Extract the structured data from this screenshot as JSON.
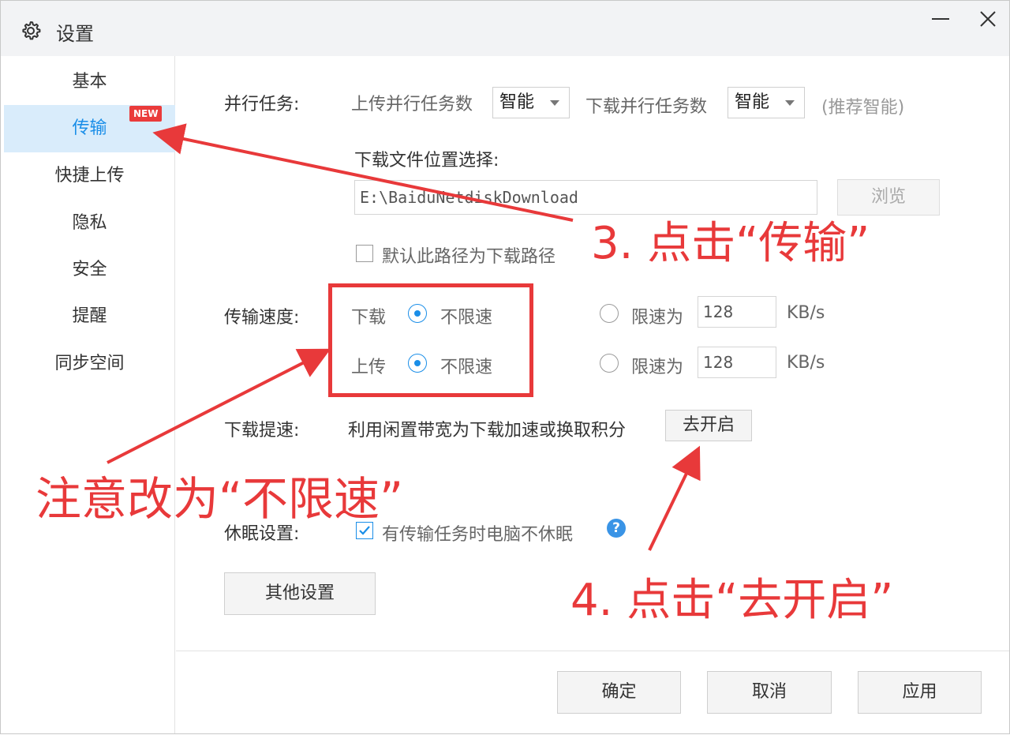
{
  "window": {
    "title": "设置"
  },
  "sidebar": {
    "items": [
      {
        "label": "基本"
      },
      {
        "label": "传输"
      },
      {
        "label": "快捷上传"
      },
      {
        "label": "隐私"
      },
      {
        "label": "安全"
      },
      {
        "label": "提醒"
      },
      {
        "label": "同步空间"
      }
    ],
    "new_badge": "NEW",
    "active_index": 1
  },
  "parallel": {
    "label": "并行任务:",
    "upload_label": "上传并行任务数",
    "upload_value": "智能",
    "download_label": "下载并行任务数",
    "download_value": "智能",
    "hint": "(推荐智能)"
  },
  "download_path": {
    "label": "下载文件位置选择:",
    "value": "E:\\BaiduNetdiskDownload",
    "browse_button": "浏览",
    "default_checkbox": "默认此路径为下载路径",
    "default_checked": false
  },
  "speed": {
    "label": "传输速度:",
    "download_label": "下载",
    "upload_label": "上传",
    "unlimited": "不限速",
    "limited": "限速为",
    "download_limit": "128",
    "upload_limit": "128",
    "unit": "KB/s",
    "download_mode": "unlimited",
    "upload_mode": "unlimited"
  },
  "accelerate": {
    "label": "下载提速:",
    "description": "利用闲置带宽为下载加速或换取积分",
    "button": "去开启"
  },
  "sleep": {
    "label": "休眠设置:",
    "checkbox": "有传输任务时电脑不休眠",
    "checked": true,
    "help": "?"
  },
  "other_settings_button": "其他设置",
  "footer": {
    "ok": "确定",
    "cancel": "取消",
    "apply": "应用"
  },
  "annotations": {
    "step3": "3. 点击“传输”",
    "note": "注意改为“不限速”",
    "step4": "4. 点击“去开启”",
    "color": "#e8393a"
  },
  "colors": {
    "accent": "#1a8ee8",
    "active_bg": "#d9ecfb",
    "badge": "#ea3b3b"
  }
}
